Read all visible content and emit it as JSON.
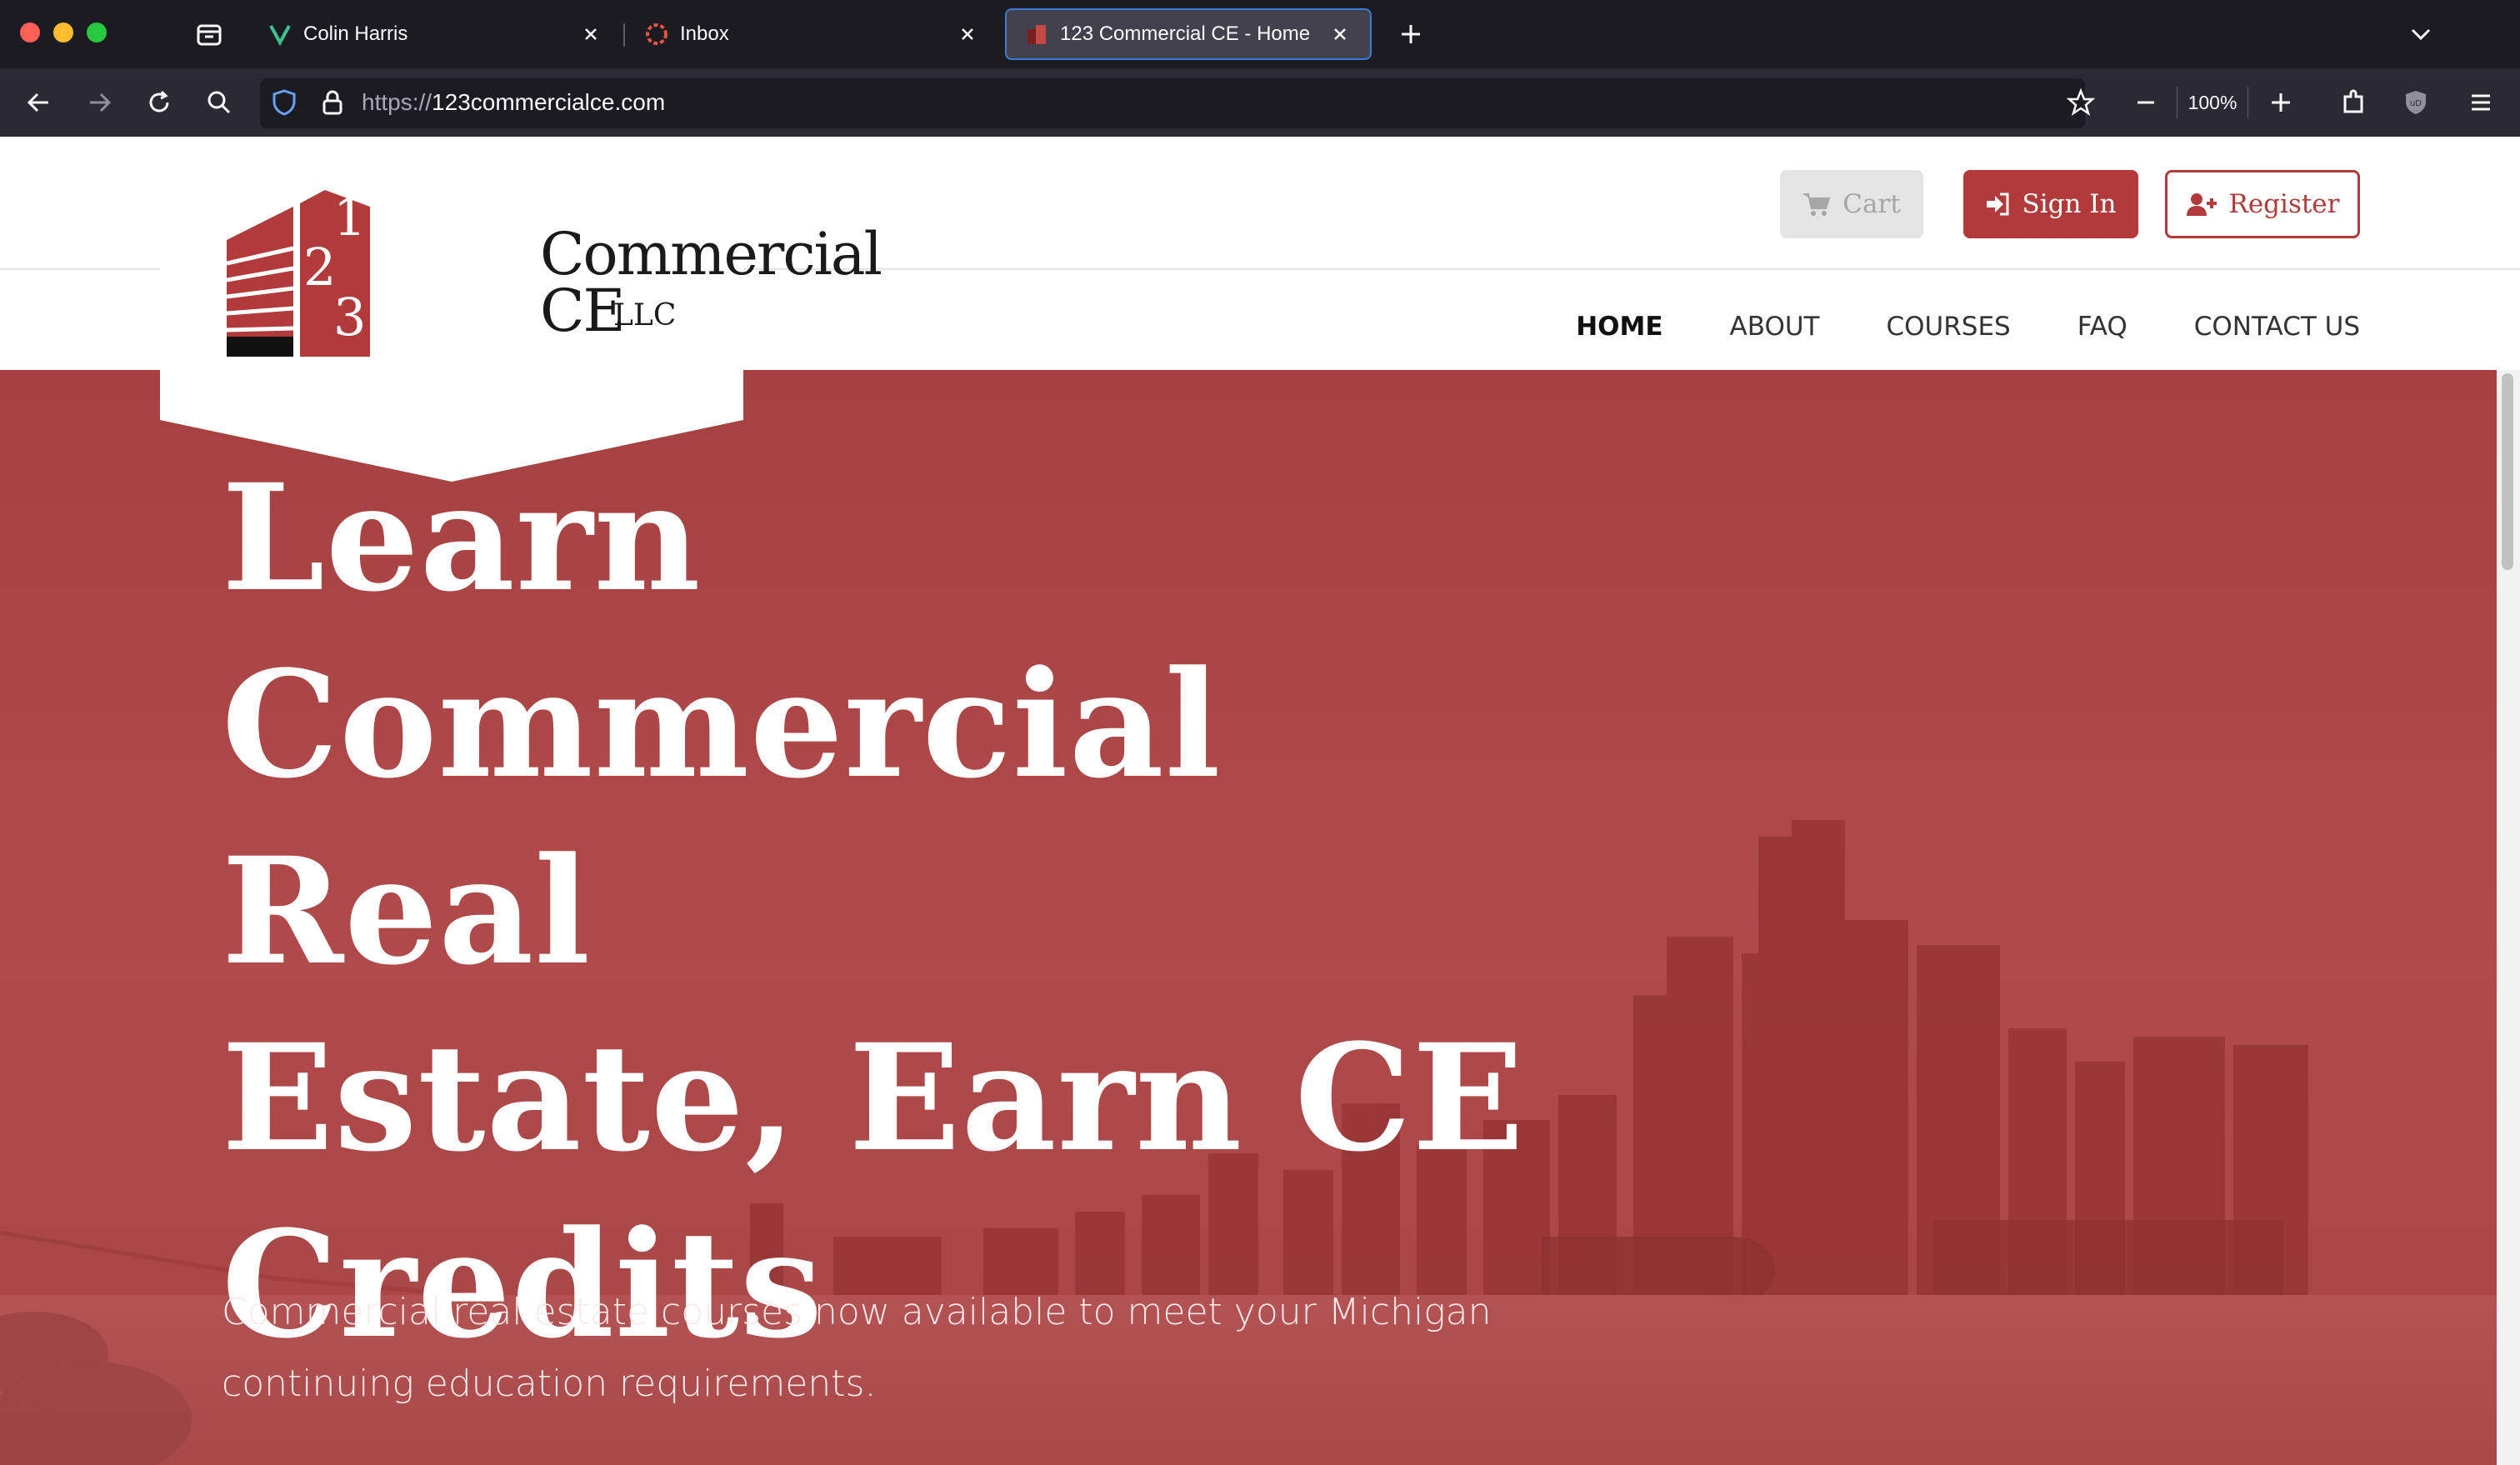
{
  "browser": {
    "tabs": [
      {
        "label": "Colin Harris",
        "favicon": "v-logo-icon",
        "active": false
      },
      {
        "label": "Inbox",
        "favicon": "inbox-icon",
        "active": false
      },
      {
        "label": "123 Commercial CE - Home",
        "favicon": "site-logo-icon",
        "active": true
      }
    ],
    "url_scheme": "https://",
    "url_host": "123commercialce.com",
    "zoom": "100%"
  },
  "header": {
    "logo": {
      "line1": "Commercial",
      "line2": "CE",
      "suffix": "LLC",
      "digits": [
        "1",
        "2",
        "3"
      ]
    },
    "cart_label": "Cart",
    "signin_label": "Sign In",
    "register_label": "Register",
    "nav": [
      {
        "label": "HOME",
        "active": true
      },
      {
        "label": "ABOUT",
        "active": false
      },
      {
        "label": "COURSES",
        "active": false
      },
      {
        "label": "FAQ",
        "active": false
      },
      {
        "label": "CONTACT US",
        "active": false
      }
    ]
  },
  "hero": {
    "title_lines": [
      "Learn",
      "Commercial Real",
      "Estate, Earn CE",
      "Credits"
    ],
    "subtitle": "Commercial real estate courses now available to meet your Michigan continuing education requirements."
  },
  "colors": {
    "brand_red": "#b23a3a",
    "hero_overlay": "#a74141",
    "browser_bg": "#1c1b22"
  }
}
